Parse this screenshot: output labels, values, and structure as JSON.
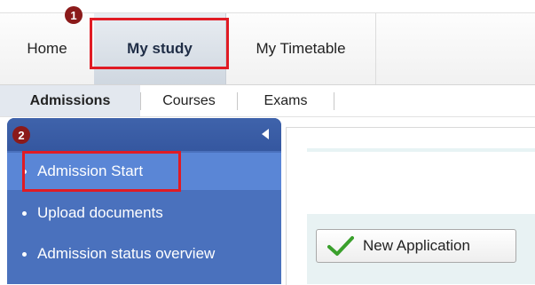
{
  "top_nav": {
    "tabs": [
      {
        "label": "Home"
      },
      {
        "label": "My study",
        "selected": true
      },
      {
        "label": "My Timetable"
      }
    ]
  },
  "sub_nav": {
    "tabs": [
      {
        "label": "Admissions",
        "selected": true
      },
      {
        "label": "Courses"
      },
      {
        "label": "Exams"
      }
    ]
  },
  "sidebar": {
    "items": [
      {
        "label": "Admission Start",
        "active": true
      },
      {
        "label": "Upload documents"
      },
      {
        "label": "Admission status overview"
      }
    ]
  },
  "main": {
    "new_application_label": "New Application"
  },
  "annotations": {
    "marker_1": "1",
    "marker_2": "2"
  },
  "colors": {
    "sidebar_bg": "#4a71bd",
    "highlight": "#e01b24",
    "marker": "#8b1a1a",
    "check": "#3aa02c"
  }
}
